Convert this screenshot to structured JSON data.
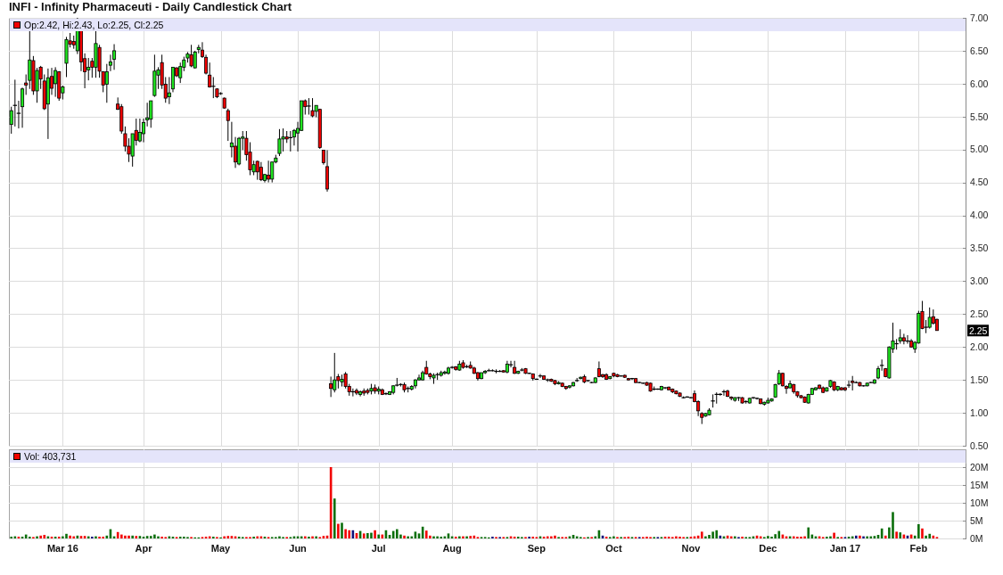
{
  "title": "INFI - Infinity Pharmaceuti - Daily Candlestick Chart",
  "price_panel": {
    "legend": "Op:2.42, Hi:2.43, Lo:2.25, Cl:2.25",
    "last_price": "2.25",
    "y_axis_labels": [
      "7.00",
      "6.50",
      "6.00",
      "5.50",
      "5.00",
      "4.50",
      "4.00",
      "3.50",
      "3.00",
      "2.50",
      "2.00",
      "1.50",
      "1.00",
      "0.50"
    ]
  },
  "volume_panel": {
    "legend": "Vol: 403,731",
    "chart_data": {
      "type": "bar",
      "stacked": true,
      "grid": true,
      "ylim": [
        0,
        21
      ],
      "categories": [
        null,
        null,
        null,
        null,
        null,
        null,
        null,
        null,
        null,
        null,
        null,
        null,
        null,
        null,
        "Mar 16",
        null,
        null,
        null,
        null,
        null,
        null,
        null,
        null,
        null,
        null,
        null,
        null,
        null,
        null,
        null,
        null,
        null,
        null,
        null,
        null,
        null,
        "Apr",
        null,
        null,
        null,
        null,
        null,
        null,
        null,
        null,
        null,
        null,
        null,
        null,
        null,
        null,
        null,
        null,
        null,
        null,
        null,
        null,
        "May",
        null,
        null,
        null,
        null,
        null,
        null,
        null,
        null,
        null,
        null,
        null,
        null,
        null,
        null,
        null,
        null,
        null,
        null,
        null,
        null,
        "Jun",
        null,
        null,
        null,
        null,
        null,
        null,
        null,
        null,
        null,
        null,
        null,
        null,
        null,
        null,
        null,
        null,
        null,
        null,
        null,
        null,
        null,
        "Jul",
        null,
        null,
        null,
        null,
        null,
        null,
        null,
        null,
        null,
        null,
        null,
        null,
        null,
        null,
        null,
        null,
        null,
        null,
        null,
        "Aug",
        null,
        null,
        null,
        null,
        null,
        null,
        null,
        null,
        null,
        null,
        null,
        null,
        null,
        null,
        null,
        null,
        null,
        null,
        null,
        null,
        null,
        null,
        "Sep",
        null,
        null,
        null,
        null,
        null,
        null,
        null,
        null,
        null,
        null,
        null,
        null,
        null,
        null,
        null,
        null,
        null,
        null,
        null,
        null,
        "Oct",
        null,
        null,
        null,
        null,
        null,
        null,
        null,
        null,
        null,
        null,
        null,
        null,
        null,
        null,
        null,
        null,
        null,
        null,
        null,
        null,
        "Nov",
        null,
        null,
        null,
        null,
        null,
        null,
        null,
        null,
        null,
        null,
        null,
        null,
        null,
        null,
        null,
        null,
        null,
        null,
        null,
        null,
        "Dec",
        null,
        null,
        null,
        null,
        null,
        null,
        null,
        null,
        null,
        null,
        null,
        null,
        null,
        null,
        null,
        null,
        null,
        null,
        null,
        null,
        "Jan 17",
        null,
        null,
        null,
        null,
        null,
        null,
        null,
        null,
        null,
        null,
        null,
        null,
        null,
        null,
        null,
        null,
        null,
        null,
        null,
        "Feb",
        null,
        null,
        null,
        null,
        null
      ],
      "yticks": [
        {
          "value": 0,
          "label": "0M"
        },
        {
          "value": 5,
          "label": "5M"
        },
        {
          "value": 10,
          "label": "10M"
        },
        {
          "value": 15,
          "label": "15M"
        },
        {
          "value": 20,
          "label": "20M"
        }
      ],
      "series": [
        {
          "color": "#0b6e0b",
          "values": [
            0.5,
            0.6,
            null,
            0.5,
            1.1,
            0.5,
            null,
            0.6,
            null,
            null,
            0.6,
            null,
            0.5,
            null,
            0.6,
            1.3,
            null,
            null,
            0.8,
            null,
            null,
            0.6,
            null,
            0.6,
            null,
            null,
            0.8,
            2.6,
            0.6,
            null,
            null,
            null,
            null,
            0.8,
            null,
            0.7,
            0.5,
            0.7,
            0.7,
            1.1,
            0.6,
            null,
            null,
            0.6,
            0.5,
            null,
            0.5,
            0.5,
            0.4,
            null,
            0.3,
            0.3,
            null,
            null,
            null,
            0.5,
            null,
            0.3,
            null,
            null,
            null,
            null,
            0.5,
            0.4,
            null,
            null,
            0.5,
            null,
            null,
            0.5,
            null,
            0.4,
            0.4,
            0.6,
            0.4,
            null,
            0.4,
            0.6,
            0.6,
            0.6,
            null,
            0.5,
            null,
            0.6,
            null,
            null,
            null,
            null,
            11.2,
            null,
            4.4,
            null,
            null,
            null,
            null,
            2.1,
            null,
            1.5,
            1.6,
            null,
            1.1,
            null,
            2.3,
            1.0,
            2.1,
            2.6,
            1.1,
            null,
            0.6,
            0.6,
            1.9,
            1.4,
            3.3,
            null,
            null,
            0.6,
            0.6,
            0.5,
            0.6,
            1.4,
            0.6,
            null,
            0.6,
            null,
            0.6,
            null,
            null,
            null,
            0.4,
            0.4,
            0.3,
            null,
            null,
            null,
            null,
            0.4,
            null,
            null,
            0.5,
            0.4,
            null,
            null,
            null,
            null,
            0.6,
            null,
            null,
            null,
            null,
            0.4,
            null,
            null,
            0.6,
            1.0,
            0.6,
            0.4,
            null,
            0.4,
            null,
            0.6,
            2.3,
            null,
            null,
            0.4,
            0.6,
            null,
            0.4,
            null,
            null,
            0.4,
            null,
            null,
            null,
            null,
            null,
            0.4,
            null,
            0.4,
            null,
            null,
            null,
            null,
            null,
            null,
            0.4,
            null,
            null,
            null,
            null,
            0.6,
            1.0,
            1.9,
            2.3,
            null,
            0.6,
            null,
            null,
            0.6,
            null,
            null,
            0.4,
            0.4,
            0.6,
            null,
            null,
            0.4,
            0.7,
            0.5,
            1.2,
            2.1,
            null,
            null,
            0.6,
            null,
            null,
            null,
            null,
            3.1,
            1.1,
            0.6,
            null,
            null,
            0.5,
            0.6,
            null,
            0.4,
            null,
            null,
            0.5,
            0.6,
            null,
            null,
            null,
            0.6,
            0.6,
            0.7,
            1.0,
            2.8,
            null,
            3.1,
            7.4,
            null,
            1.7,
            null,
            null,
            null,
            0.8,
            4.0,
            null,
            0.8,
            1.3,
            null,
            null
          ]
        },
        {
          "color": "#f20000",
          "values": [
            null,
            null,
            0.5,
            null,
            null,
            null,
            0.4,
            null,
            0.8,
            1.0,
            null,
            0.5,
            null,
            0.5,
            null,
            null,
            0.8,
            0.6,
            null,
            0.7,
            0.7,
            null,
            null,
            null,
            0.5,
            0.5,
            null,
            null,
            null,
            1.8,
            1.1,
            0.8,
            0.8,
            null,
            0.7,
            null,
            null,
            null,
            null,
            null,
            null,
            0.5,
            0.4,
            null,
            null,
            0.4,
            null,
            null,
            null,
            0.4,
            null,
            null,
            0.4,
            0.5,
            0.6,
            null,
            0.4,
            null,
            0.6,
            0.7,
            0.7,
            0.6,
            null,
            null,
            0.4,
            0.4,
            null,
            0.6,
            0.6,
            null,
            0.4,
            null,
            null,
            null,
            null,
            0.4,
            null,
            null,
            null,
            null,
            0.6,
            null,
            0.6,
            null,
            0.4,
            0.7,
            0.8,
            20.0,
            null,
            4.1,
            null,
            2.6,
            2.3,
            null,
            1.5,
            null,
            1.4,
            null,
            null,
            2.3,
            null,
            1.1,
            null,
            null,
            null,
            null,
            null,
            0.8,
            null,
            null,
            null,
            null,
            null,
            2.2,
            0.8,
            null,
            null,
            null,
            null,
            null,
            null,
            0.5,
            null,
            0.6,
            null,
            0.7,
            0.8,
            0.4,
            null,
            null,
            null,
            null,
            0.4,
            null,
            0.4,
            null,
            0.6,
            0.5,
            null,
            null,
            0.4,
            null,
            0.5,
            0.4,
            null,
            0.5,
            0.6,
            0.6,
            0.8,
            null,
            0.4,
            0.4,
            null,
            null,
            null,
            null,
            0.3,
            null,
            0.4,
            null,
            null,
            null,
            0.5,
            null,
            null,
            0.4,
            null,
            0.4,
            0.5,
            null,
            0.4,
            null,
            0.4,
            0.5,
            0.4,
            null,
            null,
            null,
            0.5,
            0.5,
            0.4,
            0.6,
            0.5,
            0.4,
            null,
            0.5,
            0.6,
            0.8,
            1.9,
            null,
            null,
            null,
            null,
            null,
            null,
            0.8,
            0.6,
            null,
            null,
            0.5,
            null,
            null,
            null,
            0.8,
            0.6,
            null,
            null,
            null,
            null,
            null,
            1.1,
            0.6,
            null,
            0.6,
            0.5,
            0.5,
            0.6,
            null,
            null,
            null,
            0.6,
            0.4,
            null,
            null,
            1.6,
            null,
            0.4,
            null,
            null,
            null,
            null,
            0.8,
            null,
            null,
            null,
            null,
            null,
            null,
            0.8,
            null,
            null,
            1.9,
            null,
            1.1,
            null,
            1.1,
            null,
            null,
            2.8,
            null,
            null,
            0.8,
            0.4
          ]
        },
        {
          "color": "#10107a",
          "values": [
            null,
            null,
            null,
            null,
            null,
            null,
            null,
            null,
            null,
            null,
            null,
            null,
            null,
            null,
            null,
            null,
            null,
            null,
            null,
            null,
            null,
            null,
            0.5,
            null,
            null,
            null,
            null,
            null,
            null,
            null,
            null,
            null,
            null,
            null,
            null,
            null,
            null,
            null,
            null,
            null,
            null,
            null,
            null,
            null,
            null,
            null,
            null,
            null,
            null,
            null,
            null,
            null,
            null,
            null,
            null,
            null,
            null,
            null,
            null,
            null,
            null,
            null,
            null,
            null,
            null,
            null,
            null,
            null,
            null,
            null,
            null,
            null,
            null,
            null,
            null,
            null,
            null,
            null,
            null,
            null,
            null,
            null,
            null,
            null,
            null,
            null,
            null,
            null,
            null,
            null,
            null,
            null,
            null,
            2.3,
            null,
            null,
            null,
            null,
            null,
            null,
            null,
            null,
            null,
            null,
            null,
            null,
            null,
            null,
            null,
            null,
            null,
            null,
            null,
            null,
            null,
            null,
            null,
            null,
            null,
            null,
            null,
            null,
            null,
            null,
            null,
            null,
            null,
            null,
            null,
            null,
            null,
            0.5,
            null,
            0.4,
            null,
            null,
            null,
            null,
            null,
            null,
            null,
            0.5,
            null,
            null,
            null,
            null,
            null,
            null,
            null,
            null,
            null,
            null,
            null,
            null,
            null,
            null,
            null,
            null,
            null,
            null,
            null,
            0.8,
            null,
            null,
            null,
            null,
            null,
            null,
            null,
            null,
            null,
            0.4,
            null,
            null,
            null,
            null,
            0.4,
            null,
            null,
            null,
            null,
            null,
            null,
            null,
            null,
            null,
            null,
            null,
            null,
            null,
            null,
            null,
            null,
            0.8,
            null,
            null,
            null,
            null,
            0.4,
            null,
            null,
            null,
            null,
            null,
            null,
            null,
            null,
            null,
            null,
            null,
            null,
            null,
            null,
            null,
            null,
            null,
            null,
            null,
            null,
            null,
            null,
            null,
            null,
            null,
            null,
            null,
            null,
            0.4,
            null,
            null,
            0.8,
            null,
            0.6,
            null,
            null,
            null,
            null,
            null,
            null,
            null,
            null,
            null,
            null,
            null,
            0.8,
            null,
            null,
            null,
            null,
            null,
            null,
            null,
            null
          ]
        }
      ]
    }
  }
}
